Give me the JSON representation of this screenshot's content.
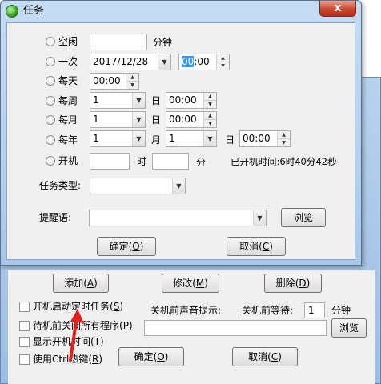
{
  "background_window": {
    "buttons": {
      "add": "添加",
      "add_key": "A",
      "modify": "修改",
      "modify_key": "M",
      "delete": "删除",
      "delete_key": "D",
      "browse": "浏览",
      "ok": "确定",
      "ok_key": "O",
      "cancel": "取消",
      "cancel_key": "C"
    },
    "checkboxes": [
      {
        "text": "开机启动定时任务",
        "key": "S",
        "checked": false
      },
      {
        "text": "待机前关闭所有程序",
        "key": "P",
        "checked": false
      },
      {
        "text": "显示开机时间",
        "key": "T",
        "checked": false
      },
      {
        "text": "使用Ctrl热键",
        "key": "R",
        "checked": false
      }
    ],
    "shutdown_sound_label": "关机前声音提示:",
    "shutdown_wait_label": "关机前等待:",
    "shutdown_wait_value": "1",
    "shutdown_wait_unit": "分钟"
  },
  "dialog": {
    "title": "任务",
    "close_symbol": "x",
    "rows": {
      "idle": {
        "label": "空闲",
        "value": "",
        "unit": "分钟"
      },
      "once": {
        "label": "一次",
        "date": "2017/12/28",
        "hour": "00",
        "time_rest": ":00"
      },
      "daily": {
        "label": "每天",
        "time": "00:00"
      },
      "weekly": {
        "label": "每周",
        "day": "1",
        "day_unit": "日",
        "time": "00:00"
      },
      "monthly": {
        "label": "每月",
        "day": "1",
        "day_unit": "日",
        "time": "00:00"
      },
      "yearly": {
        "label": "每年",
        "month": "1",
        "month_unit": "月",
        "day": "1",
        "day_unit": "日",
        "time": "00:00"
      },
      "boot": {
        "label": "开机",
        "hour_unit": "时",
        "minute_unit": "分",
        "uptime": "已开机时间:6时40分42秒"
      }
    },
    "task_type_label": "任务类型:",
    "reminder_label": "提醒语:",
    "browse": "浏览",
    "ok": "确定",
    "ok_key": "O",
    "cancel": "取消",
    "cancel_key": "C"
  },
  "icons": {
    "arrow": "red-arrow-icon",
    "dropdown": "chevron-down-icon",
    "spin": "spin-arrows-icon"
  }
}
